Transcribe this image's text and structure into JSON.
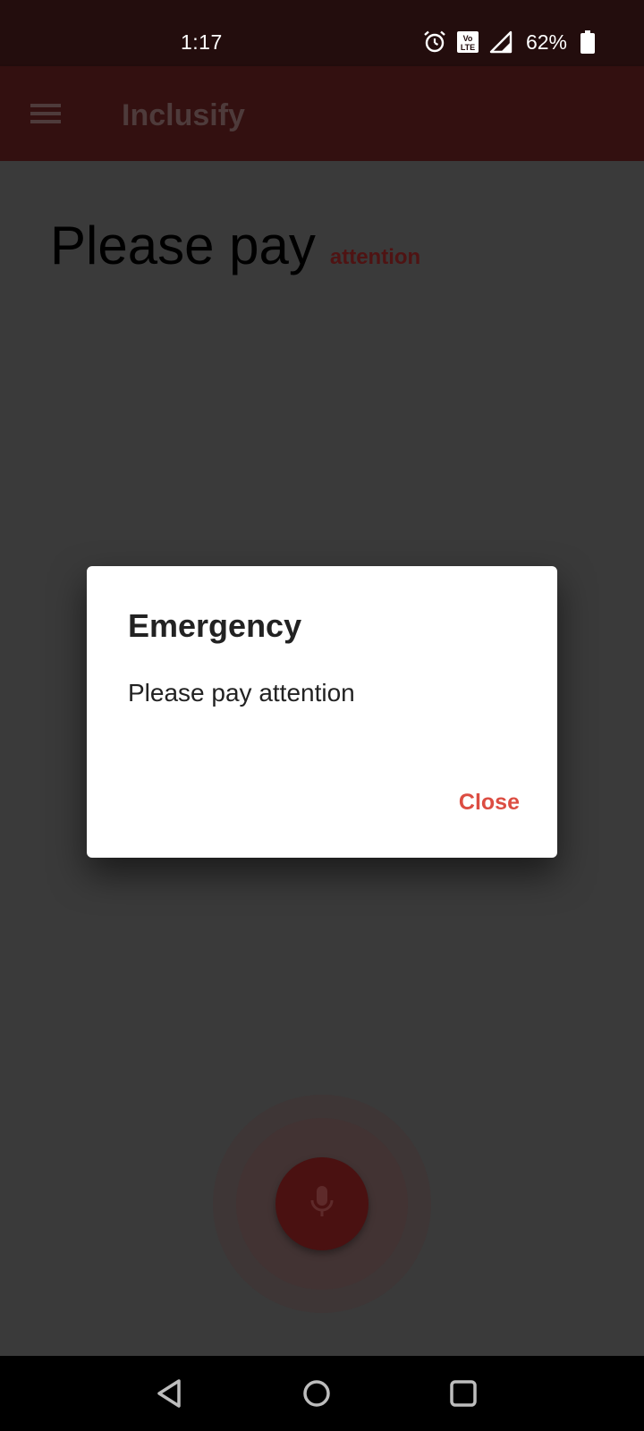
{
  "status_bar": {
    "time": "1:17",
    "volte_label": "Vo LTE",
    "battery_percent": "62%",
    "battery_level": 0.62,
    "icons": [
      "alarm-icon",
      "volte-icon",
      "signal-icon",
      "battery-icon"
    ]
  },
  "app_bar": {
    "title": "Inclusify",
    "menu_icon": "hamburger-menu-icon"
  },
  "transcript": {
    "main_text": "Please pay",
    "highlight_word": "attention"
  },
  "dialog": {
    "title": "Emergency",
    "message": "Please pay attention",
    "close_label": "Close"
  },
  "mic_button": {
    "icon": "microphone-icon"
  },
  "nav_bar": {
    "icons": [
      "back-icon",
      "home-icon",
      "recents-icon"
    ]
  },
  "colors": {
    "status_bar_bg": "#230d0d",
    "app_bar_bg": "#331010",
    "scrim_bg": "#3a3a3a",
    "accent": "#dc4d42",
    "highlight_text": "#4f1313",
    "mic_button_bg": "#4a1111"
  }
}
